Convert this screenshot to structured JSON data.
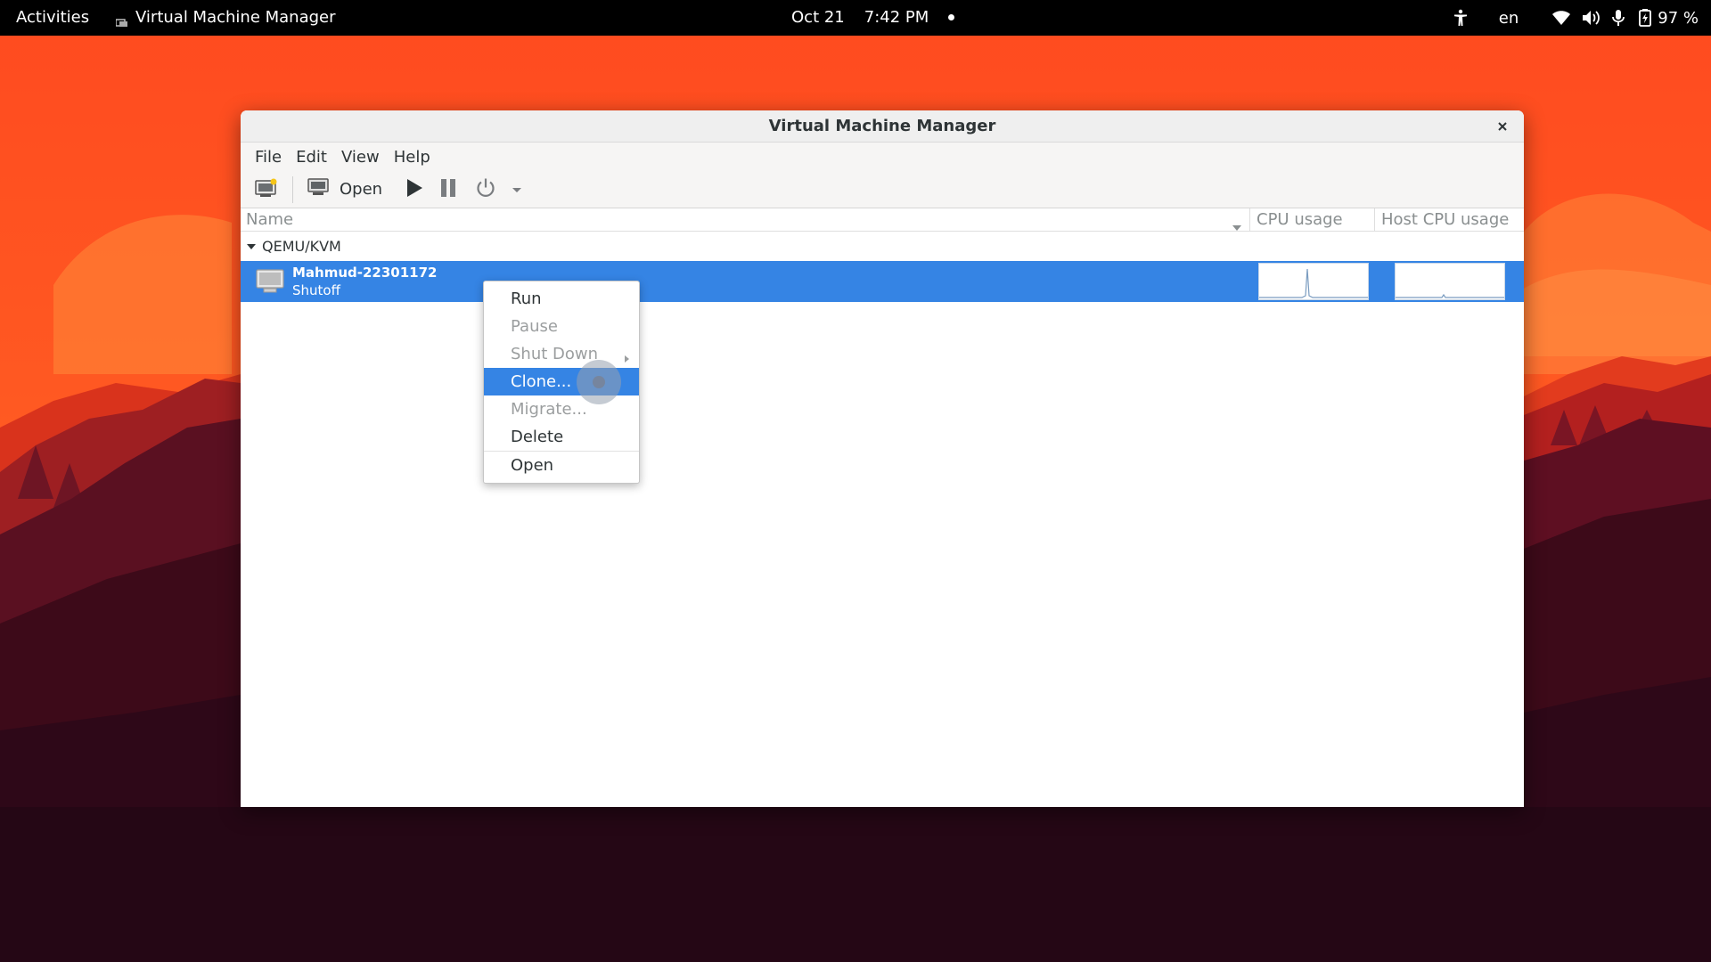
{
  "topbar": {
    "activities": "Activities",
    "app_name": "Virtual Machine Manager",
    "date": "Oct 21",
    "time": "7:42 PM",
    "language": "en",
    "battery": "97 %",
    "icons": [
      "accessibility-icon",
      "wifi-icon",
      "volume-icon",
      "microphone-icon",
      "battery-icon"
    ]
  },
  "window": {
    "title": "Virtual Machine Manager",
    "menu": [
      "File",
      "Edit",
      "View",
      "Help"
    ],
    "toolbar": {
      "new_vm_icon": "new-vm-icon",
      "open_label": "Open",
      "run_icon": "play-icon",
      "pause_icon": "pause-icon",
      "power_icon": "power-icon",
      "dropdown_icon": "dropdown-arrow-icon"
    },
    "columns": {
      "name": "Name",
      "cpu": "CPU usage",
      "host_cpu": "Host CPU usage"
    },
    "group": "QEMU/KVM",
    "vm": {
      "name": "Mahmud-22301172",
      "status": "Shutoff"
    }
  },
  "context_menu": {
    "items": [
      {
        "label": "Run",
        "enabled": true,
        "selected": false
      },
      {
        "label": "Pause",
        "enabled": false,
        "selected": false
      },
      {
        "label": "Shut Down",
        "enabled": false,
        "selected": false,
        "submenu": true
      },
      {
        "label": "Clone...",
        "enabled": true,
        "selected": true
      },
      {
        "label": "Migrate...",
        "enabled": false,
        "selected": false
      },
      {
        "label": "Delete",
        "enabled": true,
        "selected": false
      },
      {
        "label": "Open",
        "enabled": true,
        "selected": false
      }
    ]
  },
  "colors": {
    "selection": "#3584e4",
    "topbar": "#000000",
    "sky_top": "#ff4a1a",
    "sky_bottom": "#ff6a2a",
    "mountain_dark": "#2a0714"
  }
}
